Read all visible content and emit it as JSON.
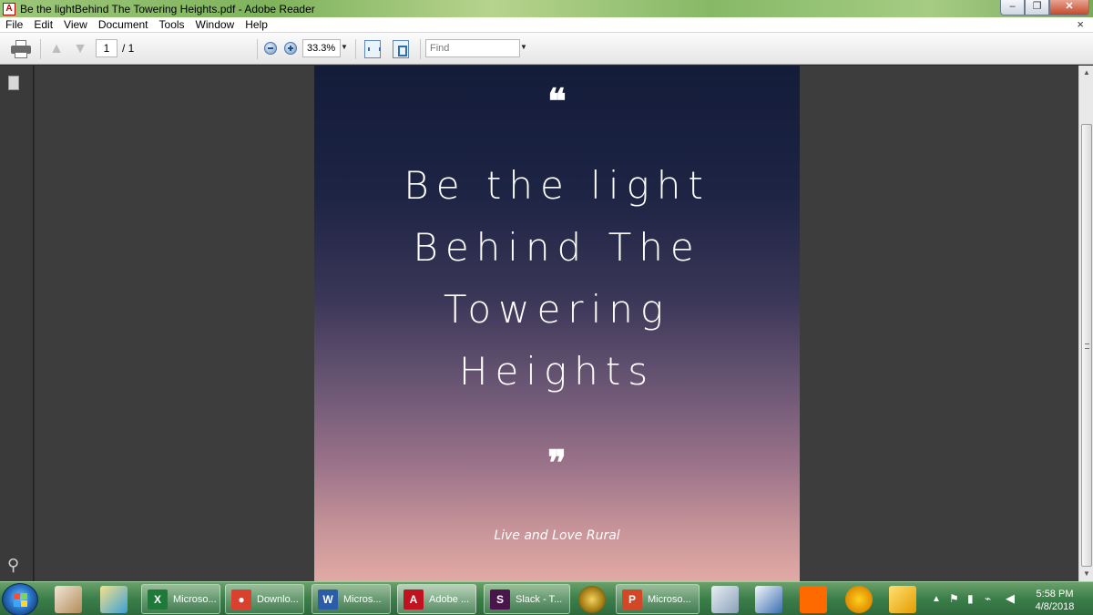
{
  "window": {
    "title": "Be the lightBehind The Towering Heights.pdf - Adobe Reader",
    "controls": {
      "minimize": "–",
      "restore": "❐",
      "close": "✕"
    }
  },
  "menu": {
    "items": [
      "File",
      "Edit",
      "View",
      "Document",
      "Tools",
      "Window",
      "Help"
    ],
    "close_doc": "×"
  },
  "toolbar": {
    "page_current": "1",
    "page_total": "/ 1",
    "zoom": "33.3%",
    "find_placeholder": "Find"
  },
  "document": {
    "quote_open": "❝",
    "headline_lines": [
      "Be the light",
      "Behind The",
      "Towering",
      "Heights"
    ],
    "quote_close": "❞",
    "tagline": "Live and Love Rural",
    "colors": {
      "top": "#131c39",
      "middle": "#6a5674",
      "bottom": "#e2aaa5"
    }
  },
  "taskbar": {
    "buttons": [
      {
        "label": "Microso...",
        "icon": "excel-icon",
        "color": "#1f7a3a",
        "glyph": "X"
      },
      {
        "label": "Downlo...",
        "icon": "chrome-icon",
        "color": "#d9412e",
        "glyph": "●"
      },
      {
        "label": "Micros...",
        "icon": "word-icon",
        "color": "#2b5ca8",
        "glyph": "W"
      },
      {
        "label": "Adobe ...",
        "icon": "adobe-reader-icon",
        "color": "#c1121f",
        "glyph": "A"
      },
      {
        "label": "Slack - T...",
        "icon": "slack-icon",
        "color": "#4a154b",
        "glyph": "S"
      },
      {
        "label": "Microso...",
        "icon": "powerpoint-icon",
        "color": "#d24726",
        "glyph": "P"
      }
    ],
    "clock": {
      "time": "5:58 PM",
      "date": "4/8/2018"
    }
  }
}
